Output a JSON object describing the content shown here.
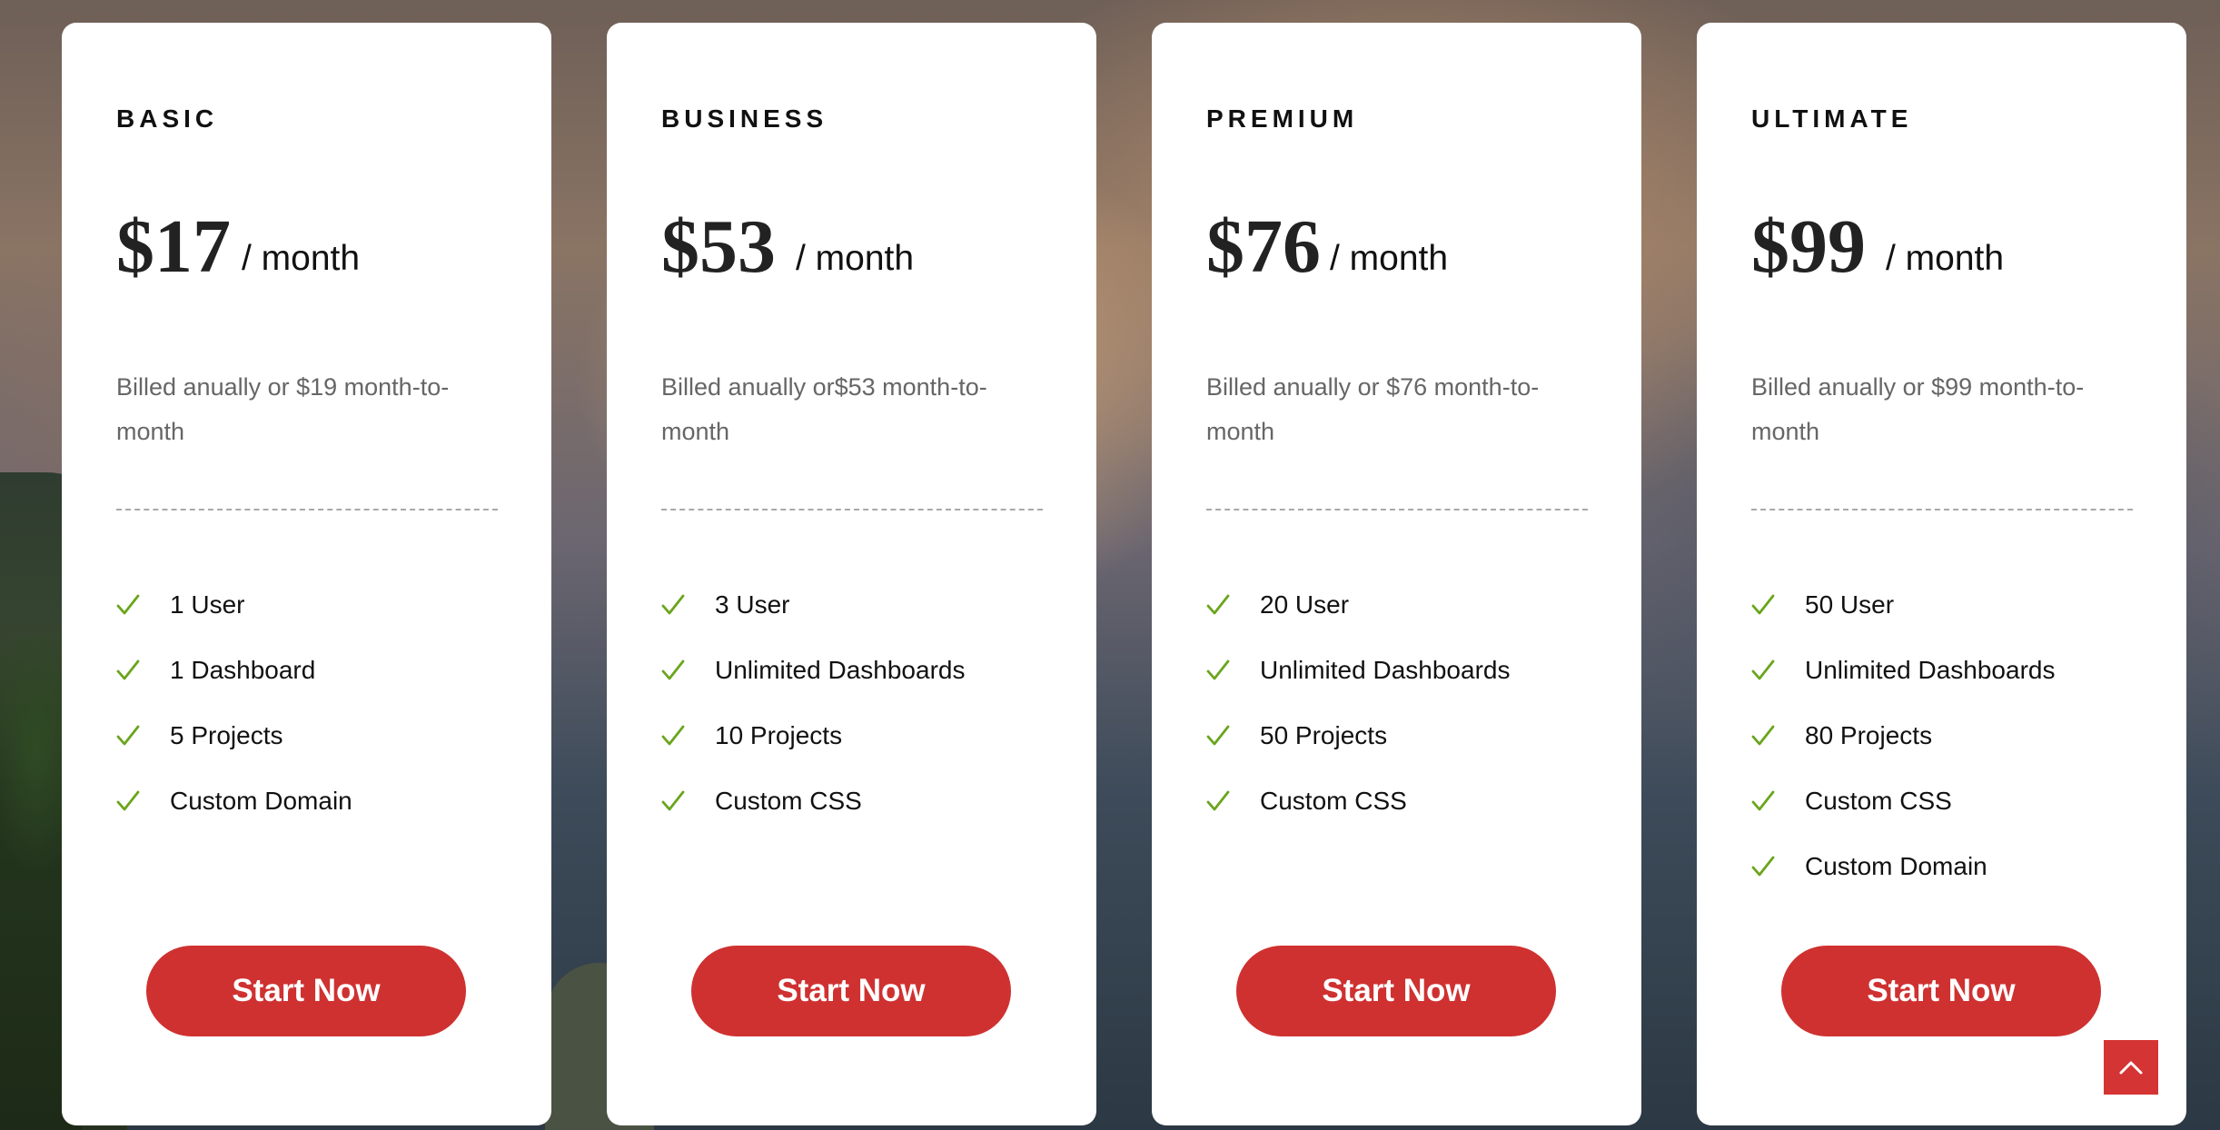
{
  "colors": {
    "accent": "#cf3131",
    "check": "#6aa51c",
    "card_bg": "#ffffff",
    "muted_text": "#666666"
  },
  "plans": [
    {
      "name": "BASIC",
      "price": "$17",
      "period": "/ month",
      "billing": "Billed anually or $19 month-to-month",
      "features": [
        "1 User",
        "1 Dashboard",
        "5 Projects",
        "Custom Domain"
      ],
      "cta": "Start Now"
    },
    {
      "name": "BUSINESS",
      "price": "$53",
      "period": "/ month",
      "billing": "Billed anually or$53 month-to-month",
      "features": [
        "3 User",
        "Unlimited Dashboards",
        "10 Projects",
        "Custom CSS"
      ],
      "cta": "Start Now"
    },
    {
      "name": "PREMIUM",
      "price": "$76",
      "period": "/ month",
      "billing": "Billed anually or $76 month-to-month",
      "features": [
        "20 User",
        "Unlimited Dashboards",
        "50 Projects",
        "Custom CSS"
      ],
      "cta": "Start Now"
    },
    {
      "name": "ULTIMATE",
      "price": "$99",
      "period": "/ month",
      "billing": "Billed anually or $99 month-to-month",
      "features": [
        "50 User",
        "Unlimited Dashboards",
        "80 Projects",
        "Custom CSS",
        "Custom Domain"
      ],
      "cta": "Start Now"
    }
  ],
  "icons": {
    "feature_check": "check-icon",
    "scroll_top": "chevron-up-icon"
  }
}
